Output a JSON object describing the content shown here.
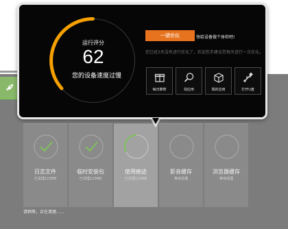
{
  "popup": {
    "gauge_label": "运行评分",
    "score": "62",
    "speed_desc": "您的设备速度过慢",
    "optimize_label": "一键优化",
    "optimize_msg": "快给设备做个体检吧!",
    "optimize_sub": "您已经3天没有进行优化了，欢迎您手建议您每天进行一次优化。",
    "tools": [
      {
        "label": "每日推荐",
        "icon": "gift-icon"
      },
      {
        "label": "找应用",
        "icon": "search-icon"
      },
      {
        "label": "我的应用",
        "icon": "box-icon"
      },
      {
        "label": "打开U盘",
        "icon": "usb-icon"
      }
    ],
    "gauge_color": "#f5a000",
    "accent": "#e8731e"
  },
  "cards": [
    {
      "label": "日志文件",
      "sub": "已清理123MB",
      "state": "done"
    },
    {
      "label": "临时安装包",
      "sub": "已清理123MB",
      "state": "done"
    },
    {
      "label": "使用痕迹",
      "sub": "已清理123MB",
      "state": "in-progress"
    },
    {
      "label": "影音缓存",
      "sub": "等待清理",
      "state": "pending"
    },
    {
      "label": "浏览器缓存",
      "sub": "等待清理",
      "state": "pending"
    }
  ],
  "status_text": "请稍等，正在清理......",
  "side_tab_icon": "rocket-icon"
}
